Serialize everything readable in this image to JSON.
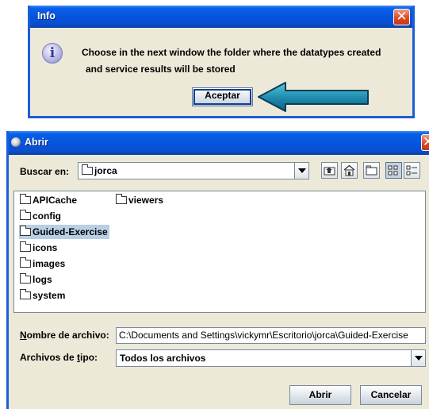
{
  "info_dialog": {
    "title": "Info",
    "close_glyph": "✕",
    "info_icon_glyph": "i",
    "message_line1": "Choose in the next window the folder where the datatypes created",
    "message_line2": "and service results will be stored",
    "accept_label": "Aceptar"
  },
  "open_dialog": {
    "title": "Abrir",
    "close_glyph": "✕",
    "look_in_label": "Buscar en:",
    "look_in_value": "jorca",
    "files": [
      {
        "name": "APICache",
        "selected": false
      },
      {
        "name": "config",
        "selected": false
      },
      {
        "name": "Guided-Exercise",
        "selected": true
      },
      {
        "name": "icons",
        "selected": false
      },
      {
        "name": "images",
        "selected": false
      },
      {
        "name": "logs",
        "selected": false
      },
      {
        "name": "system",
        "selected": false
      },
      {
        "name": "viewers",
        "selected": false
      }
    ],
    "filename_label_mnemonic": "N",
    "filename_label_rest": "ombre de archivo:",
    "filename_value": "C:\\Documents and Settings\\vickymr\\Escritorio\\jorca\\Guided-Exercise",
    "filetype_label_prefix": "Archivos de ",
    "filetype_label_mnemonic": "t",
    "filetype_label_suffix": "ipo:",
    "filetype_value": "Todos los archivos",
    "open_label": "Abrir",
    "cancel_label": "Cancelar"
  },
  "icons": [
    "info-icon",
    "close-icon",
    "folder-icon",
    "up-folder-icon",
    "home-icon",
    "new-folder-icon",
    "list-view-icon",
    "details-view-icon",
    "arrow-pointer"
  ],
  "colors": {
    "titlebar": "#0553dc",
    "dialog_bg": "#ece9d8",
    "selection": "#b8cfe5",
    "arrow": "#1f8fb0"
  }
}
